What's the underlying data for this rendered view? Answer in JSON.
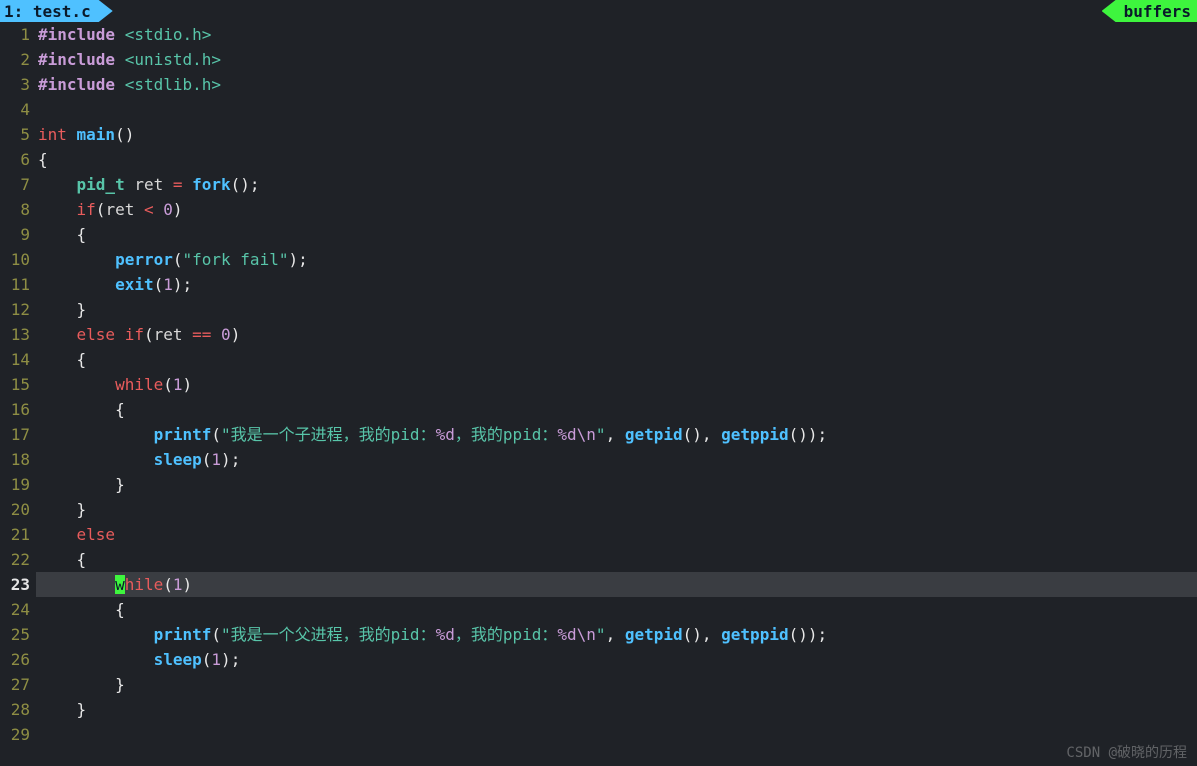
{
  "tabs": {
    "left_label": "1: test.c",
    "right_label": "buffers"
  },
  "editor": {
    "current_line": 23,
    "lines": [
      {
        "n": 1,
        "tokens": [
          [
            "pp",
            "#include "
          ],
          [
            "inc",
            "<stdio.h>"
          ]
        ]
      },
      {
        "n": 2,
        "tokens": [
          [
            "pp",
            "#include "
          ],
          [
            "inc",
            "<unistd.h>"
          ]
        ]
      },
      {
        "n": 3,
        "tokens": [
          [
            "pp",
            "#include "
          ],
          [
            "inc",
            "<stdlib.h>"
          ]
        ]
      },
      {
        "n": 4,
        "tokens": []
      },
      {
        "n": 5,
        "tokens": [
          [
            "kw",
            "int "
          ],
          [
            "fn",
            "main"
          ],
          [
            "paren",
            "()"
          ]
        ]
      },
      {
        "n": 6,
        "tokens": [
          [
            "punc",
            "{"
          ]
        ]
      },
      {
        "n": 7,
        "tokens": [
          [
            "plain",
            "    "
          ],
          [
            "type",
            "pid_t "
          ],
          [
            "plain",
            "ret "
          ],
          [
            "op",
            "= "
          ],
          [
            "fn",
            "fork"
          ],
          [
            "paren",
            "()"
          ],
          [
            "punc",
            ";"
          ]
        ]
      },
      {
        "n": 8,
        "tokens": [
          [
            "plain",
            "    "
          ],
          [
            "kw",
            "if"
          ],
          [
            "paren",
            "("
          ],
          [
            "plain",
            "ret "
          ],
          [
            "op",
            "< "
          ],
          [
            "num",
            "0"
          ],
          [
            "paren",
            ")"
          ]
        ]
      },
      {
        "n": 9,
        "tokens": [
          [
            "plain",
            "    "
          ],
          [
            "punc",
            "{"
          ]
        ]
      },
      {
        "n": 10,
        "tokens": [
          [
            "plain",
            "        "
          ],
          [
            "fn",
            "perror"
          ],
          [
            "paren",
            "("
          ],
          [
            "str",
            "\"fork fail\""
          ],
          [
            "paren",
            ")"
          ],
          [
            "punc",
            ";"
          ]
        ]
      },
      {
        "n": 11,
        "tokens": [
          [
            "plain",
            "        "
          ],
          [
            "fn",
            "exit"
          ],
          [
            "paren",
            "("
          ],
          [
            "num",
            "1"
          ],
          [
            "paren",
            ")"
          ],
          [
            "punc",
            ";"
          ]
        ]
      },
      {
        "n": 12,
        "tokens": [
          [
            "plain",
            "    "
          ],
          [
            "punc",
            "}"
          ]
        ]
      },
      {
        "n": 13,
        "tokens": [
          [
            "plain",
            "    "
          ],
          [
            "kw",
            "else if"
          ],
          [
            "paren",
            "("
          ],
          [
            "plain",
            "ret "
          ],
          [
            "op",
            "== "
          ],
          [
            "num",
            "0"
          ],
          [
            "paren",
            ")"
          ]
        ]
      },
      {
        "n": 14,
        "tokens": [
          [
            "plain",
            "    "
          ],
          [
            "punc",
            "{"
          ]
        ]
      },
      {
        "n": 15,
        "tokens": [
          [
            "plain",
            "        "
          ],
          [
            "kw",
            "while"
          ],
          [
            "paren",
            "("
          ],
          [
            "num",
            "1"
          ],
          [
            "paren",
            ")"
          ]
        ]
      },
      {
        "n": 16,
        "tokens": [
          [
            "plain",
            "        "
          ],
          [
            "punc",
            "{"
          ]
        ]
      },
      {
        "n": 17,
        "tokens": [
          [
            "plain",
            "            "
          ],
          [
            "fn",
            "printf"
          ],
          [
            "paren",
            "("
          ],
          [
            "str",
            "\"我是一个子进程，我的pid："
          ],
          [
            "esc",
            "%d"
          ],
          [
            "str",
            "，我的ppid："
          ],
          [
            "esc",
            "%d"
          ],
          [
            "esc",
            "\\n"
          ],
          [
            "str",
            "\""
          ],
          [
            "punc",
            ", "
          ],
          [
            "fn",
            "getpid"
          ],
          [
            "paren",
            "()"
          ],
          [
            "punc",
            ", "
          ],
          [
            "fn",
            "getppid"
          ],
          [
            "paren",
            "()"
          ],
          [
            "paren",
            ")"
          ],
          [
            "punc",
            ";"
          ]
        ]
      },
      {
        "n": 18,
        "tokens": [
          [
            "plain",
            "            "
          ],
          [
            "fn",
            "sleep"
          ],
          [
            "paren",
            "("
          ],
          [
            "num",
            "1"
          ],
          [
            "paren",
            ")"
          ],
          [
            "punc",
            ";"
          ]
        ]
      },
      {
        "n": 19,
        "tokens": [
          [
            "plain",
            "        "
          ],
          [
            "punc",
            "}"
          ]
        ]
      },
      {
        "n": 20,
        "tokens": [
          [
            "plain",
            "    "
          ],
          [
            "punc",
            "}"
          ]
        ]
      },
      {
        "n": 21,
        "tokens": [
          [
            "plain",
            "    "
          ],
          [
            "kw",
            "else"
          ]
        ]
      },
      {
        "n": 22,
        "tokens": [
          [
            "plain",
            "    "
          ],
          [
            "punc",
            "{"
          ]
        ]
      },
      {
        "n": 23,
        "tokens": [
          [
            "plain",
            "        "
          ],
          [
            "cursor",
            "w"
          ],
          [
            "kw",
            "hile"
          ],
          [
            "paren",
            "("
          ],
          [
            "num",
            "1"
          ],
          [
            "paren",
            ")"
          ]
        ]
      },
      {
        "n": 24,
        "tokens": [
          [
            "plain",
            "        "
          ],
          [
            "punc",
            "{"
          ]
        ]
      },
      {
        "n": 25,
        "tokens": [
          [
            "plain",
            "            "
          ],
          [
            "fn",
            "printf"
          ],
          [
            "paren",
            "("
          ],
          [
            "str",
            "\"我是一个父进程，我的pid："
          ],
          [
            "esc",
            "%d"
          ],
          [
            "str",
            "，我的ppid："
          ],
          [
            "esc",
            "%d"
          ],
          [
            "esc",
            "\\n"
          ],
          [
            "str",
            "\""
          ],
          [
            "punc",
            ", "
          ],
          [
            "fn",
            "getpid"
          ],
          [
            "paren",
            "()"
          ],
          [
            "punc",
            ", "
          ],
          [
            "fn",
            "getppid"
          ],
          [
            "paren",
            "()"
          ],
          [
            "paren",
            ")"
          ],
          [
            "punc",
            ";"
          ]
        ]
      },
      {
        "n": 26,
        "tokens": [
          [
            "plain",
            "            "
          ],
          [
            "fn",
            "sleep"
          ],
          [
            "paren",
            "("
          ],
          [
            "num",
            "1"
          ],
          [
            "paren",
            ")"
          ],
          [
            "punc",
            ";"
          ]
        ]
      },
      {
        "n": 27,
        "tokens": [
          [
            "plain",
            "        "
          ],
          [
            "punc",
            "}"
          ]
        ]
      },
      {
        "n": 28,
        "tokens": [
          [
            "plain",
            "    "
          ],
          [
            "punc",
            "}"
          ]
        ]
      },
      {
        "n": 29,
        "tokens": []
      }
    ]
  },
  "watermark": "CSDN @破晓的历程"
}
